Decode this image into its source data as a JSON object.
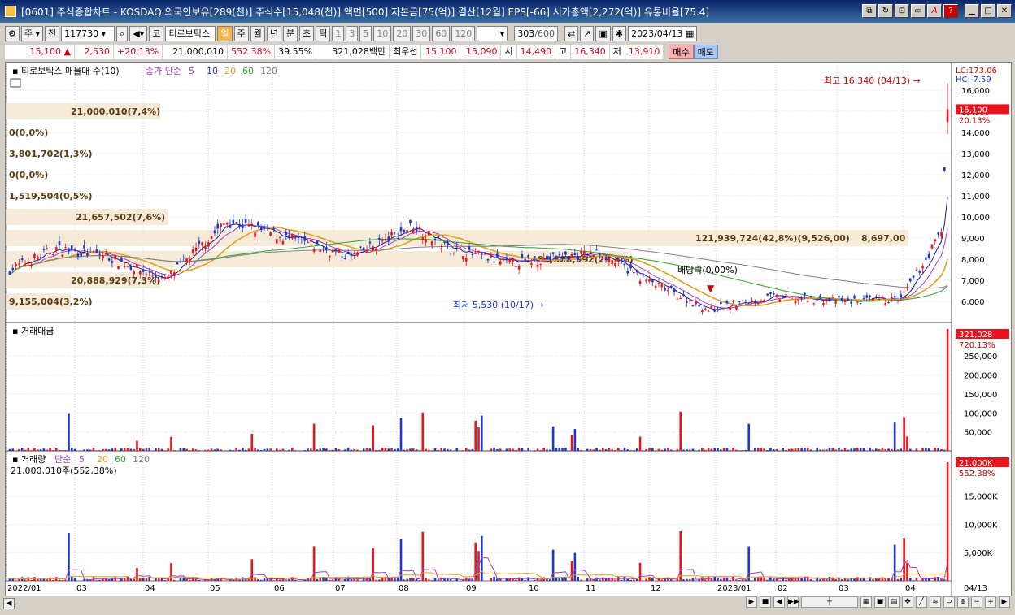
{
  "window": {
    "title": "[0601] 주식종합차트 - KOSDAQ 외국인보유[289(천)] 주식수[15,048(천)] 액면[500] 자본금[75(억)] 결산[12월] EPS[-66] 시가총액[2,272(억)] 유통비율[75.4]",
    "buttons": [
      "link-icon",
      "refresh-icon",
      "pin-icon",
      "print-icon",
      "font-icon",
      "help-icon",
      "minimize-icon",
      "maximize-icon",
      "close-icon"
    ]
  },
  "toolbar": {
    "market": "주",
    "prev": "전",
    "code": "117730",
    "name": "티로보틱스",
    "periods": [
      "일",
      "주",
      "월",
      "년",
      "분",
      "초",
      "틱"
    ],
    "active_period": "일",
    "intervals": [
      "1",
      "3",
      "5",
      "10",
      "20",
      "30",
      "60",
      "120"
    ],
    "count": "303",
    "count_total": "/600",
    "date": "2023/04/13",
    "kor": "코"
  },
  "quote": {
    "price": "15,100",
    "change": "2,530",
    "change_pct": "+20.13%",
    "volume": "21,000,010",
    "vol_ratio": "552.38%",
    "turnover": "39.55%",
    "amount": "321,028백만",
    "best_label": "최우선",
    "best_ask": "15,100",
    "best_bid": "15,090",
    "open_label": "시",
    "open": "14,490",
    "high_label": "고",
    "high": "16,340",
    "low_label": "저",
    "low": "13,910",
    "buy": "매수",
    "sell": "매도"
  },
  "chart_data": [
    {
      "type": "candlestick",
      "title": "티로보틱스 매물대 수(10)",
      "indicator_legend": [
        "종가 단순",
        "5",
        "10",
        "20",
        "60",
        "120"
      ],
      "ylim": [
        5000,
        17000
      ],
      "y_ticks": [
        "6,000",
        "7,000",
        "8,000",
        "9,000",
        "10,000",
        "11,000",
        "12,000",
        "13,000",
        "14,000",
        "15,000",
        "16,000"
      ],
      "current_price_label": "15,100",
      "current_pct_label": "20.13%",
      "lc_label": "LC:173.06",
      "hc_label": "HC:-7.59",
      "high_annotation": "최고 16,340 (04/13)",
      "low_annotation": "최저 5,530 (10/17)",
      "dividend_annotation": "배당락(0,00%)",
      "volume_profile": [
        {
          "label": "21,000,010(7,4%)",
          "price": 15000
        },
        {
          "label": "0(0,0%)",
          "price": 14000
        },
        {
          "label": "3,801,702(1,3%)",
          "price": 13000
        },
        {
          "label": "0(0,0%)",
          "price": 12000
        },
        {
          "label": "1,519,504(0,5%)",
          "price": 11000
        },
        {
          "label": "21,657,502(7,6%)",
          "price": 10000
        },
        {
          "label": "121,939,724(42,8%)(9,526,00)",
          "price": 9000
        },
        {
          "label": "84,888,992(29,8%)",
          "price": 8000
        },
        {
          "label": "20,888,929(7,3%)",
          "price": 7000
        },
        {
          "label": "9,155,004(3,2%)",
          "price": 6000
        }
      ],
      "pivot_label": "8,697,00"
    },
    {
      "type": "bar",
      "title": "거래대금",
      "ylim": [
        0,
        321028
      ],
      "y_ticks": [
        "50,000",
        "100,000",
        "150,000",
        "200,000",
        "250,000"
      ],
      "current_label": "321,028",
      "current_pct": "720.13%"
    },
    {
      "type": "bar",
      "title": "거래량",
      "legend": [
        "단순",
        "5",
        "20",
        "60",
        "120"
      ],
      "subtitle": "21,000,010주(552,38%)",
      "ylim": [
        0,
        21000000
      ],
      "y_ticks": [
        "5,000K",
        "10,000K",
        "15,000K"
      ],
      "current_label": "21,000K",
      "current_pct": "552.38%"
    }
  ],
  "x_axis": [
    "2022/01",
    "03",
    "04",
    "05",
    "06",
    "07",
    "08",
    "09",
    "10",
    "11",
    "12",
    "2023/01",
    "02",
    "03",
    "04"
  ],
  "x_axis_end": "04/13",
  "colors": {
    "up": "#e8141e",
    "down": "#1a37d6",
    "ma5": "#1a1a8c",
    "ma10": "#a040c0",
    "ma20": "#e0a020",
    "ma60": "#30a030",
    "ma120": "#808080",
    "profile": "#f5e6d2"
  }
}
